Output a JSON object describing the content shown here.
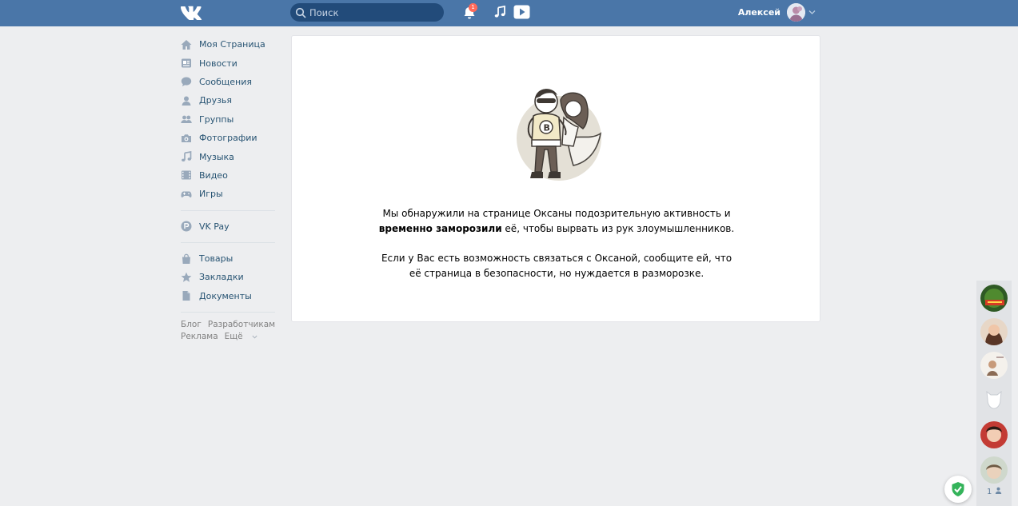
{
  "header": {
    "logo": "vk-logo",
    "search_placeholder": "Поиск",
    "notification_count": "1",
    "user_name": "Алексей"
  },
  "sidebar": {
    "items": [
      {
        "label": "Моя Страница",
        "icon": "home-icon"
      },
      {
        "label": "Новости",
        "icon": "news-icon"
      },
      {
        "label": "Сообщения",
        "icon": "messages-icon"
      },
      {
        "label": "Друзья",
        "icon": "friends-icon"
      },
      {
        "label": "Группы",
        "icon": "groups-icon"
      },
      {
        "label": "Фотографии",
        "icon": "camera-icon"
      },
      {
        "label": "Музыка",
        "icon": "music-icon"
      },
      {
        "label": "Видео",
        "icon": "video-icon"
      },
      {
        "label": "Игры",
        "icon": "gamepad-icon"
      }
    ],
    "pay": {
      "label": "VK Pay",
      "icon": "vkpay-icon"
    },
    "extra": [
      {
        "label": "Товары",
        "icon": "bag-icon"
      },
      {
        "label": "Закладки",
        "icon": "star-icon"
      },
      {
        "label": "Документы",
        "icon": "document-icon"
      }
    ],
    "footer": {
      "blog": "Блог",
      "developers": "Разработчикам",
      "ads": "Реклама",
      "more": "Ещё"
    }
  },
  "main": {
    "message_part1": "Мы обнаружили на странице Оксаны подозрительную активность и ",
    "message_bold": "временно заморозили",
    "message_part2": " её, чтобы вырвать из рук злоумышленников.",
    "message2": "Если у Вас есть возможность связаться с Оксаной, сообщите ей, что её страница в безопасности, но нуждается в разморозке."
  },
  "rightbar": {
    "online_count": "1"
  },
  "colors": {
    "header": "#4a76a8",
    "link": "#285473",
    "background": "#edeef0"
  }
}
